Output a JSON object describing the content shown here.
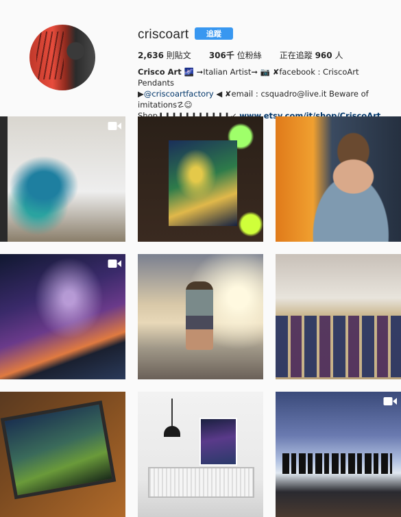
{
  "profile": {
    "username": "criscoart",
    "follow_label": "追蹤",
    "stats": {
      "posts_count": "2,636",
      "posts_label": "則貼文",
      "followers_count": "306千",
      "followers_label": "位粉絲",
      "following_prefix": "正在追蹤",
      "following_count": "960",
      "following_suffix": "人"
    },
    "bio": {
      "name": "Crisco Art 🌌",
      "line1_rest": " ➞Italian Artist➞ 📷 ✘facebook : CriscoArt Pendants",
      "line2_prefix": "▶",
      "mention": "@criscoartfactory",
      "line2_rest": " ◀ ✘email : csquadro@live.it Beware of imitations☡☺",
      "line3_prefix": "Shop⬇⬇⬇⬇⬇⬇⬇⬇⬇⬇⬇↙ ",
      "link": "www.etsy.com/it/shop/CriscoArt"
    }
  },
  "grid": {
    "posts": [
      {
        "media": "video",
        "icon": "video-camera-icon"
      },
      {
        "media": "photo"
      },
      {
        "media": "photo"
      },
      {
        "media": "video",
        "icon": "video-camera-icon"
      },
      {
        "media": "photo"
      },
      {
        "media": "photo"
      },
      {
        "media": "photo"
      },
      {
        "media": "photo"
      },
      {
        "media": "video",
        "icon": "video-camera-icon"
      }
    ]
  },
  "colors": {
    "accent": "#3897f0",
    "link": "#003569",
    "text": "#262626",
    "background": "#fafafa"
  }
}
